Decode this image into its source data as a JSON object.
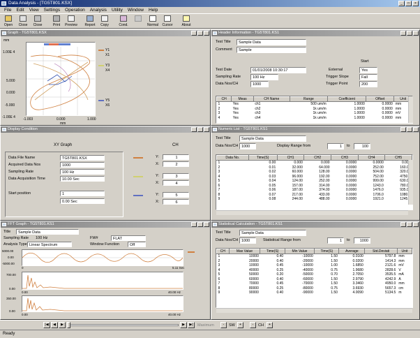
{
  "window": {
    "title": "Data Analysis - [TG5T801.KSX]"
  },
  "menu": [
    "File",
    "Edit",
    "View",
    "Settings",
    "Operation",
    "Analysis",
    "Utility",
    "Window",
    "Help"
  ],
  "toolbar": [
    "Open",
    "Close",
    "Close",
    "Print",
    "Preview",
    "Report",
    "Copy",
    "Cond.",
    "",
    "Normal",
    "Cursor",
    "About"
  ],
  "graph": {
    "title": "Graph - TG5T801.KSX",
    "ylabels": [
      "1.00E 4",
      "5.000",
      "0.000",
      "-5.000",
      "-1.00E 4"
    ],
    "xlabels": [
      "-1.003",
      "0.000",
      "1.000"
    ],
    "xunit": "mm",
    "yunit": "mm",
    "legend": [
      {
        "ch": "Y1",
        "x": "X1",
        "color": "#d08040"
      },
      {
        "ch": "Y3",
        "x": "X4",
        "color": "#d0d070"
      },
      {
        "ch": "Y5",
        "x": "X6",
        "color": "#6070c0"
      }
    ]
  },
  "header": {
    "title": "Header Information - TG5T801.KS1",
    "test_title_label": "Test Title",
    "test_title": "Sample Data",
    "comment_label": "Comment",
    "comment": "Sample",
    "start_label": "Start",
    "test_date_label": "Test Date",
    "test_date": "01/01/2008 10:30:17",
    "external_label": "External",
    "external": "Yes",
    "sampling_rate_label": "Sampling Rate",
    "sampling_rate": "100 Hz",
    "trigger_slope_label": "Trigger Slope",
    "trigger_slope": "Fall",
    "data_nos_label": "Data Nos/CH",
    "data_nos": "1000",
    "trigger_point_label": "Trigger Point",
    "trigger_point": "200",
    "columns": [
      "CH",
      "Meas",
      "CH Name",
      "Range",
      "Coefficient",
      "Offset",
      "Unit"
    ],
    "rows": [
      [
        "1",
        "Yes",
        "ch1",
        "500 um/m",
        "1.0000",
        "0.0000",
        "mm"
      ],
      [
        "2",
        "Yes",
        "ch2",
        "1k um/m",
        "1.0000",
        "0.0000",
        "mm"
      ],
      [
        "3",
        "Yes",
        "ch3",
        "1k um/m",
        "1.0000",
        "0.0000",
        "mV"
      ],
      [
        "4",
        "Yes",
        "ch4",
        "1k um/m",
        "1.0000",
        "0.0000",
        "mm"
      ]
    ]
  },
  "display": {
    "title": "Display Condition",
    "xy_graph": "XY Graph",
    "ch_label": "CH",
    "file_name_label": "Data File Name",
    "file_name": "TG5T801.KSX",
    "acquired_label": "Acquired Data Nos",
    "acquired": "1000",
    "sampling_label": "Sampling Rate",
    "sampling": "100 Hz",
    "acq_time_label": "Data Acquisition Time",
    "acq_time": "10.00 Sec",
    "start_label": "Start position",
    "start": "1",
    "start_sec": "0.00 Sec",
    "pairs": [
      {
        "y": "1",
        "x": "2",
        "color": "#d08040"
      },
      {
        "y": "3",
        "x": "4",
        "color": "#d0d070"
      },
      {
        "y": "5",
        "x": "6",
        "color": "#6070c0"
      }
    ],
    "ylab": "Y:",
    "xlab": "X:"
  },
  "numeric": {
    "title": "Numeric List - TG5T801.KS1",
    "test_title_label": "Test Title",
    "test_title": "Sample Data",
    "data_nos_label": "Data Nos/CH",
    "data_nos": "1000",
    "range_label": "Display Range  from",
    "from": "1",
    "to_label": "to",
    "to": "100",
    "columns": [
      "Data No.",
      "Time(S)",
      "CH1",
      "CH2",
      "CH3",
      "CH4",
      "CH5"
    ],
    "rows": [
      [
        "1",
        "0.00",
        "0.000",
        "0.000",
        "0.0000",
        "0.0000",
        "0.000"
      ],
      [
        "2",
        "0.01",
        "32.000",
        "64.000",
        "0.0000",
        "252.00",
        "160.00"
      ],
      [
        "3",
        "0.02",
        "60.000",
        "128.00",
        "0.0000",
        "504.00",
        "320.00"
      ],
      [
        "4",
        "0.03",
        "96.000",
        "192.00",
        "0.0000",
        "752.00",
        "4750.0"
      ],
      [
        "5",
        "0.04",
        "124.00",
        "252.00",
        "0.0000",
        "999.00",
        "630.00"
      ],
      [
        "6",
        "0.05",
        "157.00",
        "314.00",
        "0.0000",
        "1243.0",
        "780.00"
      ],
      [
        "7",
        "0.06",
        "187.00",
        "374.00",
        "0.0000",
        "1476.0",
        "935.00"
      ],
      [
        "8",
        "0.07",
        "217.00",
        "433.00",
        "0.0000",
        "1706.0",
        "1080.0"
      ],
      [
        "9",
        "0.08",
        "244.00",
        "488.00",
        "0.0000",
        "1921.0",
        "1245.0"
      ]
    ]
  },
  "fft": {
    "title": "FFT Graph - TG5T801.KS1",
    "title_label": "Title",
    "title_value": "Sample Data",
    "sampling_label": "Sampling Rate",
    "sampling": "100 Hz",
    "fw_label": "FW#",
    "fw": "FLAT",
    "analysis_label": "Analysis Type",
    "analysis": "Linear Spectrum",
    "window_label": "Window Function",
    "window": "Off",
    "plot1_y": [
      "5000.00",
      "0.00",
      "-5000.00"
    ],
    "plot1_x": [
      "0",
      "5.11 Sec"
    ],
    "plot2_y": [
      "700.00",
      "0.00"
    ],
    "plot2_x": [
      "0.00",
      "40.00 Hz"
    ],
    "plot3_y": [
      "350.00",
      "0.00"
    ],
    "plot3_x": [
      "0.00",
      "40.00 Hz"
    ]
  },
  "stats": {
    "title": "Statistical Calculation - TG5T801.KS1",
    "test_title_label": "Test Title",
    "test_title": "Sample Data",
    "data_nos_label": "Data Nos/CH",
    "data_nos": "1000",
    "range_label": "Statistical Range  from",
    "from": "1",
    "to_label": "to",
    "to": "1000",
    "columns": [
      "CH",
      "Max Value",
      "Time(S)",
      "Min Value",
      "Time(S)",
      "Average",
      "Std.Deviati",
      "Unit"
    ],
    "rows": [
      [
        "1",
        "10000",
        "0.40",
        "-10000",
        "1.50",
        "0.0100",
        "5797.8",
        "mm"
      ],
      [
        "2",
        "20000",
        "0.40",
        "-20000",
        "1.50",
        "0.0200",
        "1414.3",
        "mm"
      ],
      [
        "3",
        "10000",
        "0.45",
        "-10000",
        "1.00",
        "1.6850",
        "2121.6",
        "mV"
      ],
      [
        "4",
        "40000",
        "0.25",
        "-40000",
        "0.75",
        "1.9680",
        "2828.6",
        "V"
      ],
      [
        "5",
        "50000",
        "0.20",
        "-50000",
        "0.70",
        "2.7050",
        "3535.5",
        "mA"
      ],
      [
        "6",
        "60000",
        "0.40",
        "-60000",
        "1.50",
        "2.9790",
        "4242.9",
        "A"
      ],
      [
        "7",
        "70000",
        "0.45",
        "-70000",
        "1.50",
        "3.3460",
        "4950.0",
        "mm"
      ],
      [
        "8",
        "80000",
        "0.25",
        "-80000",
        "0.75",
        "3.6930",
        "5657.3",
        "cm"
      ],
      [
        "9",
        "90000",
        "0.40",
        "-90000",
        "1.50",
        "4.0090",
        "5134.5",
        "m"
      ]
    ]
  },
  "status": {
    "text": "Ready",
    "maximum": "Maximum",
    "sw_label": "SW",
    "ch_label": "CH"
  }
}
